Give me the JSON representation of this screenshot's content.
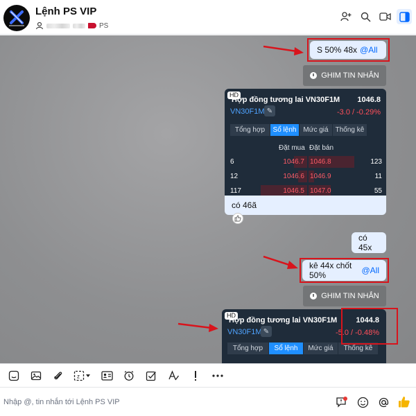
{
  "header": {
    "title": "Lệnh PS VIP",
    "subline_tag": "PS",
    "avatar_text": "X"
  },
  "messages": {
    "msg1": {
      "text": "S 50% 48x",
      "mention": "@All"
    },
    "pin_label": "GHIM TIN NHẮN",
    "card1": {
      "hd": "HD",
      "title": "Hợp đồng tương lai VN30F1M",
      "price": "1046.8",
      "symbol": "VN30F1M",
      "change": "-3.0 / -0.29%",
      "tabs": [
        "Tổng hợp",
        "Sổ lệnh",
        "Mức giá",
        "Thống kê"
      ],
      "bid_header": "Đặt mua",
      "ask_header": "Đặt bán",
      "rows": [
        {
          "bid_qty": "6",
          "bid": "1046.7",
          "ask": "1046.8",
          "ask_qty": "123"
        },
        {
          "bid_qty": "12",
          "bid": "1046.6",
          "ask": "1046.9",
          "ask_qty": "11"
        },
        {
          "bid_qty": "117",
          "bid": "1046.5",
          "ask": "1047.0",
          "ask_qty": "55"
        }
      ],
      "footer": "có 46ã"
    },
    "msg2": {
      "text": "có 45x"
    },
    "msg3": {
      "text": "kê 44x chốt 50%",
      "mention": "@All"
    },
    "card2": {
      "hd": "HD",
      "title": "Hợp đồng tương lai VN30F1M",
      "price": "1044.8",
      "symbol": "VN30F1M",
      "change": "-5.0 / -0.48%",
      "tabs": [
        "Tổng hợp",
        "Sổ lệnh",
        "Mức giá",
        "Thống kê"
      ]
    }
  },
  "composer": {
    "placeholder": "Nhập @, tin nhắn tới Lệnh PS VIP"
  },
  "colors": {
    "accent": "#0068ff",
    "annotation_red": "#d8141c",
    "bubble_bg": "#e5efff",
    "card_bg": "#1f2c3a",
    "negative": "#ff4f5a"
  },
  "icons": {
    "header": [
      "add-member-icon",
      "search-icon",
      "video-call-icon",
      "sidebar-toggle-icon"
    ],
    "toolbar": [
      "sticker-icon",
      "image-icon",
      "attachment-icon",
      "screenshot-icon",
      "contact-card-icon",
      "reminder-icon",
      "task-icon",
      "format-text-icon",
      "priority-icon",
      "more-icon"
    ],
    "composer": [
      "quick-message-icon",
      "emoji-icon",
      "mention-icon",
      "like-icon"
    ]
  }
}
